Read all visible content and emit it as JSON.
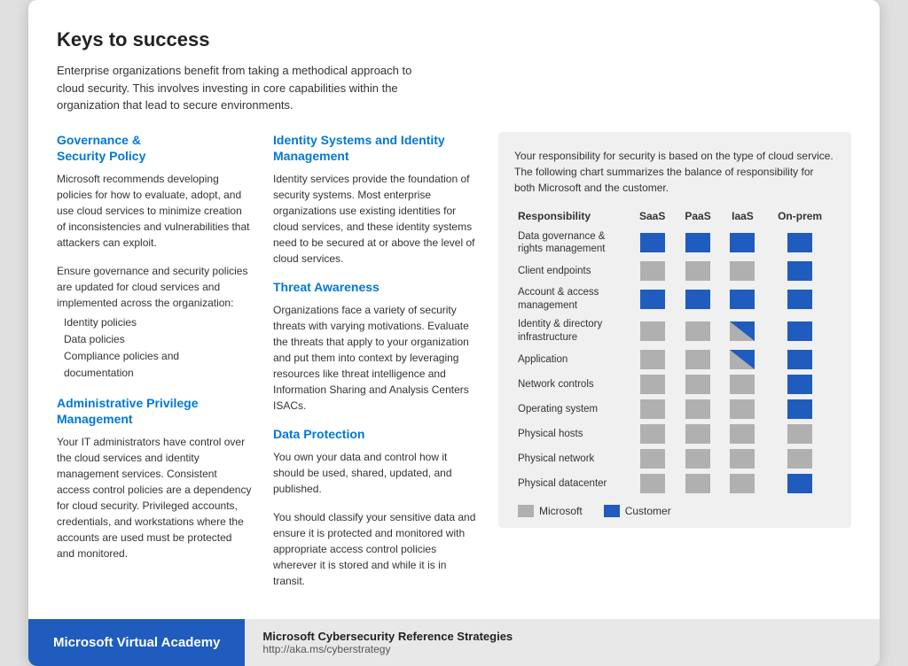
{
  "card": {
    "title": "Keys to success",
    "intro": "Enterprise organizations benefit from taking a methodical approach to cloud security. This involves investing in core capabilities within the organization that lead to secure environments."
  },
  "left": {
    "section1_heading": "Governance &\nSecurity Policy",
    "section1_body1": "Microsoft recommends developing policies for how to evaluate, adopt, and use cloud services to minimize creation of inconsistencies and vulnerabilities that attackers can exploit.",
    "section1_body2": "Ensure governance and security policies are updated for cloud services and implemented across the organization:",
    "section1_list": [
      "Identity policies",
      "Data policies",
      "Compliance policies and documentation"
    ],
    "section2_heading": "Administrative Privilege Management",
    "section2_body": "Your IT administrators have control over the cloud services and identity management services. Consistent access control policies are a dependency for cloud security. Privileged accounts, credentials, and workstations where the accounts are used must be protected and monitored."
  },
  "center": {
    "section1_heading": "Identity Systems and Identity Management",
    "section1_body": "Identity services provide the foundation of security systems. Most enterprise organizations use existing identities for cloud services, and these identity systems need to be secured at or above the level of cloud services.",
    "section2_heading": "Threat Awareness",
    "section2_body": "Organizations face a variety of security threats with varying motivations. Evaluate the threats that apply to your organization and put them into context by leveraging resources like threat intelligence and Information Sharing and Analysis Centers ISACs.",
    "section3_heading": "Data Protection",
    "section3_body1": "You own your data and control how it should be used, shared, updated, and published.",
    "section3_body2": "You should classify your sensitive data and ensure it is protected and monitored with appropriate access control policies wherever it is stored and while it is in transit."
  },
  "right": {
    "intro": "Your responsibility for security is based on the type of cloud service. The following chart summarizes the balance of responsibility for both Microsoft and the customer.",
    "col_responsibility": "Responsibility",
    "col_saas": "SaaS",
    "col_paas": "PaaS",
    "col_iaas": "IaaS",
    "col_onprem": "On-prem",
    "rows": [
      {
        "label": "Data governance &\nrights management",
        "saas": "blue",
        "paas": "blue",
        "iaas": "blue",
        "onprem": "blue"
      },
      {
        "label": "Client endpoints",
        "saas": "gray",
        "paas": "gray",
        "iaas": "gray",
        "onprem": "blue"
      },
      {
        "label": "Account & access\nmanagement",
        "saas": "blue",
        "paas": "blue",
        "iaas": "blue",
        "onprem": "blue"
      },
      {
        "label": "Identity & directory\ninfrastructure",
        "saas": "gray",
        "paas": "gray",
        "iaas": "diag-gray-blue",
        "onprem": "blue"
      },
      {
        "label": "Application",
        "saas": "gray",
        "paas": "gray",
        "iaas": "diag-gray-blue",
        "onprem": "blue"
      },
      {
        "label": "Network controls",
        "saas": "gray",
        "paas": "gray",
        "iaas": "gray",
        "onprem": "blue"
      },
      {
        "label": "Operating system",
        "saas": "gray",
        "paas": "gray",
        "iaas": "gray",
        "onprem": "blue"
      },
      {
        "label": "Physical hosts",
        "saas": "gray",
        "paas": "gray",
        "iaas": "gray",
        "onprem": "gray"
      },
      {
        "label": "Physical network",
        "saas": "gray",
        "paas": "gray",
        "iaas": "gray",
        "onprem": "gray"
      },
      {
        "label": "Physical datacenter",
        "saas": "gray",
        "paas": "gray",
        "iaas": "gray",
        "onprem": "blue"
      }
    ],
    "legend_microsoft": "Microsoft",
    "legend_customer": "Customer"
  },
  "footer": {
    "left_label": "Microsoft Virtual Academy",
    "right_main": "Microsoft Cybersecurity Reference Strategies",
    "right_url": "http://aka.ms/cyberstrategy"
  }
}
